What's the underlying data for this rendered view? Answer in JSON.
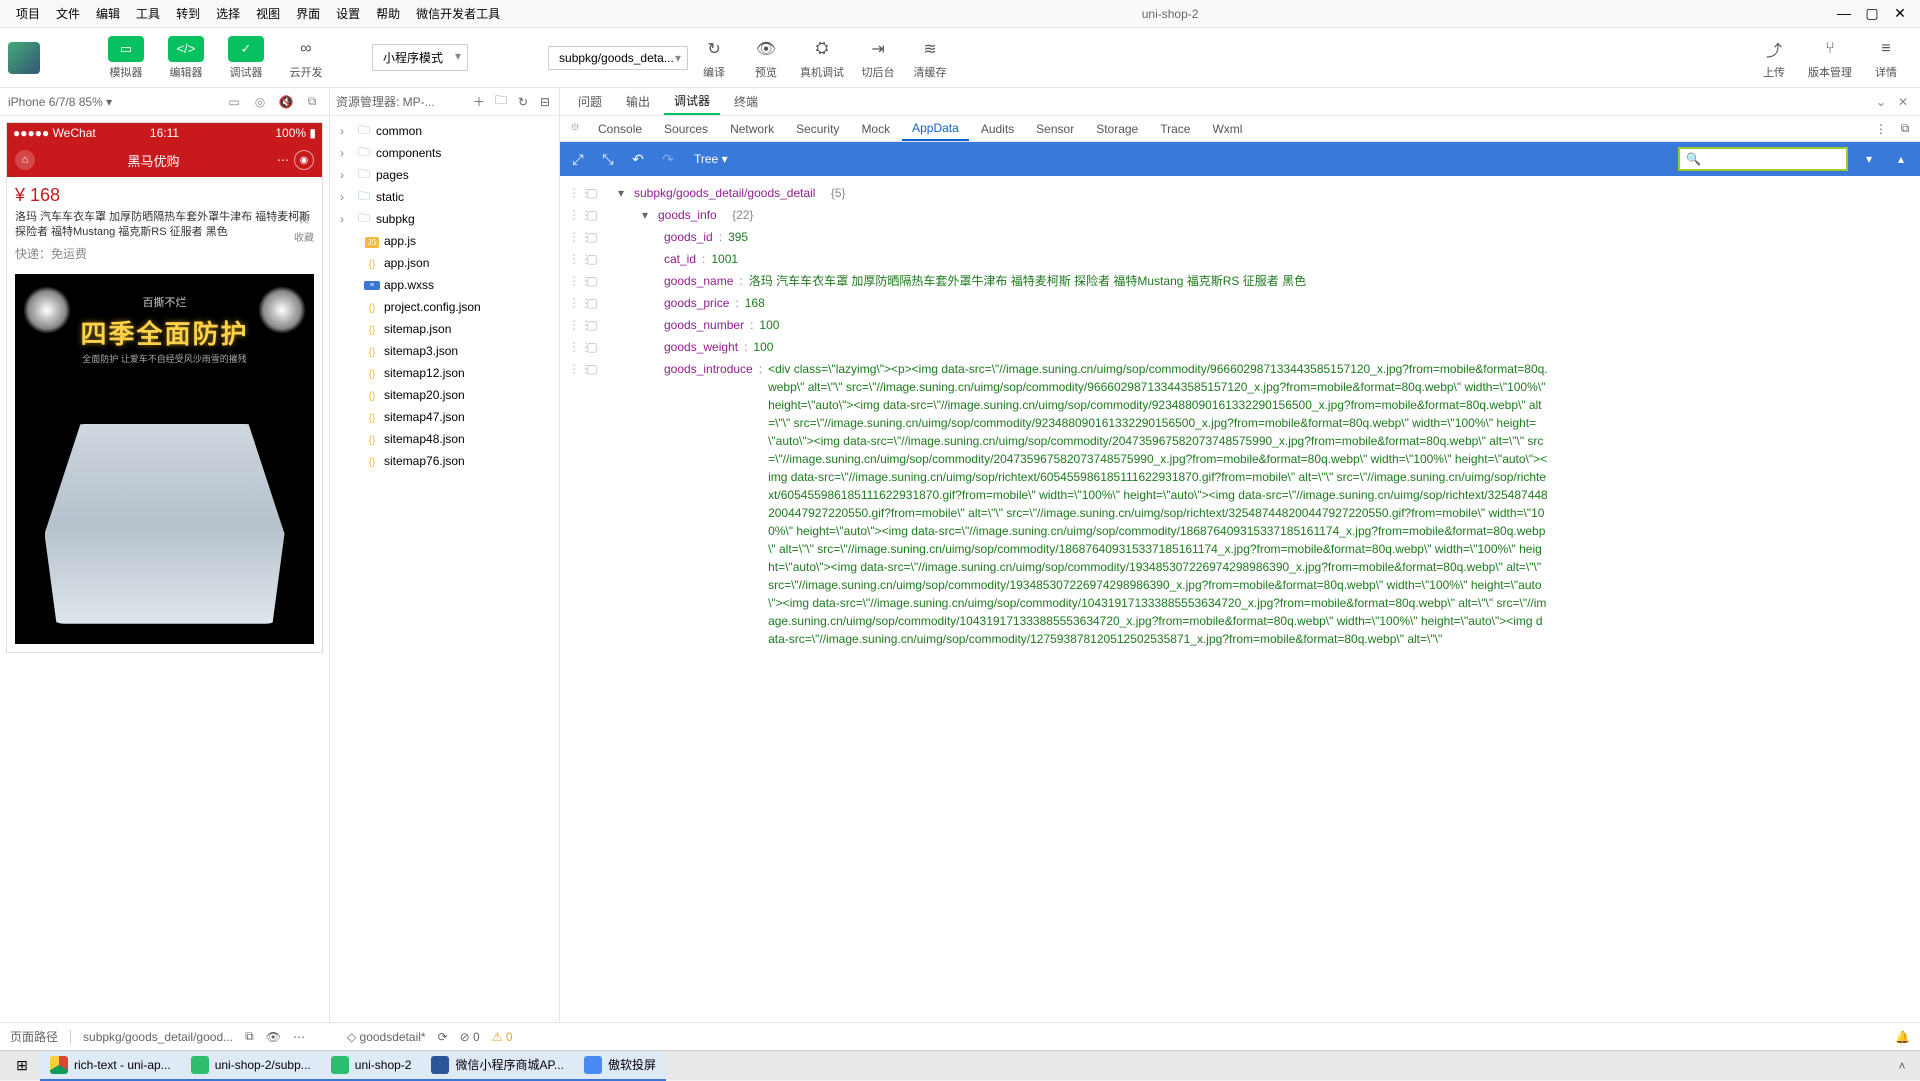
{
  "menu": [
    "项目",
    "文件",
    "编辑",
    "工具",
    "转到",
    "选择",
    "视图",
    "界面",
    "设置",
    "帮助",
    "微信开发者工具"
  ],
  "app_title": "uni-shop-2",
  "win": {
    "min": "—",
    "max": "▢",
    "close": "✕"
  },
  "toolbar": {
    "sim": "模拟器",
    "editor": "编辑器",
    "debugger": "调试器",
    "cloud": "云开发",
    "mode": "小程序模式",
    "page": "subpkg/goods_deta...",
    "compile": "编译",
    "preview": "预览",
    "realdebug": "真机调试",
    "background": "切后台",
    "clear": "清缓存",
    "upload": "上传",
    "version": "版本管理",
    "detail": "详情"
  },
  "sim": {
    "device": "iPhone 6/7/8 85%",
    "wechat": "●●●●● WeChat",
    "time": "16:11",
    "battery": "100%",
    "nav_title": "黑马优购"
  },
  "product": {
    "price": "¥ 168",
    "title": "洛玛 汽车车衣车罩 加厚防晒隔热车套外罩牛津布 福特麦柯斯 探险者 福特Mustang 福克斯RS 征服者 黑色",
    "fav": "收藏",
    "ship_label": "快递：",
    "ship_val": "免运费",
    "banner1": "百撕不烂",
    "banner2": "四季全面防护",
    "banner3": "全面防护 让爱车不自经受风沙雨雪的摧残"
  },
  "explorer": {
    "title": "资源管理器: MP-...",
    "folders": [
      "common",
      "components",
      "pages",
      "static",
      "subpkg"
    ],
    "files": [
      "app.js",
      "app.json",
      "app.wxss",
      "project.config.json",
      "sitemap.json",
      "sitemap3.json",
      "sitemap12.json",
      "sitemap20.json",
      "sitemap47.json",
      "sitemap48.json",
      "sitemap76.json"
    ]
  },
  "tabs_top": [
    "问题",
    "输出",
    "调试器",
    "终端"
  ],
  "tabs_top_active": "调试器",
  "dev_tabs": [
    "Console",
    "Sources",
    "Network",
    "Security",
    "Mock",
    "AppData",
    "Audits",
    "Sensor",
    "Storage",
    "Trace",
    "Wxml"
  ],
  "dev_active": "AppData",
  "tree_mode": "Tree",
  "appdata": {
    "path": "subpkg/goods_detail/goods_detail",
    "path_count": "{5}",
    "goods_info": "goods_info",
    "goods_info_count": "{22}",
    "goods_id_k": "goods_id",
    "goods_id_v": "395",
    "cat_id_k": "cat_id",
    "cat_id_v": "1001",
    "goods_name_k": "goods_name",
    "goods_name_v": "洛玛 汽车车衣车罩 加厚防晒隔热车套外罩牛津布 福特麦柯斯 探险者 福特Mustang 福克斯RS 征服者 黑色",
    "goods_price_k": "goods_price",
    "goods_price_v": "168",
    "goods_number_k": "goods_number",
    "goods_number_v": "100",
    "goods_weight_k": "goods_weight",
    "goods_weight_v": "100",
    "goods_introduce_k": "goods_introduce",
    "goods_introduce_v": "<div class=\\\"lazyimg\\\"><p><img data-src=\\\"//image.suning.cn/uimg/sop/commodity/966602987133443585157120_x.jpg?from=mobile&format=80q.webp\\\" alt=\\\"\\\" src=\\\"//image.suning.cn/uimg/sop/commodity/966602987133443585157120_x.jpg?from=mobile&format=80q.webp\\\" width=\\\"100%\\\" height=\\\"auto\\\"><img data-src=\\\"//image.suning.cn/uimg/sop/commodity/923488090161332290156500_x.jpg?from=mobile&format=80q.webp\\\" alt=\\\"\\\" src=\\\"//image.suning.cn/uimg/sop/commodity/923488090161332290156500_x.jpg?from=mobile&format=80q.webp\\\" width=\\\"100%\\\" height=\\\"auto\\\"><img data-src=\\\"//image.suning.cn/uimg/sop/commodity/204735967582073748575990_x.jpg?from=mobile&format=80q.webp\\\" alt=\\\"\\\" src=\\\"//image.suning.cn/uimg/sop/commodity/204735967582073748575990_x.jpg?from=mobile&format=80q.webp\\\" width=\\\"100%\\\" height=\\\"auto\\\"><img data-src=\\\"//image.suning.cn/uimg/sop/richtext/605455986185111622931870.gif?from=mobile\\\" alt=\\\"\\\" src=\\\"//image.suning.cn/uimg/sop/richtext/605455986185111622931870.gif?from=mobile\\\" width=\\\"100%\\\" height=\\\"auto\\\"><img data-src=\\\"//image.suning.cn/uimg/sop/richtext/325487448200447927220550.gif?from=mobile\\\" alt=\\\"\\\" src=\\\"//image.suning.cn/uimg/sop/richtext/325487448200447927220550.gif?from=mobile\\\" width=\\\"100%\\\" height=\\\"auto\\\"><img data-src=\\\"//image.suning.cn/uimg/sop/commodity/186876409315337185161174_x.jpg?from=mobile&format=80q.webp\\\" alt=\\\"\\\" src=\\\"//image.suning.cn/uimg/sop/commodity/186876409315337185161174_x.jpg?from=mobile&format=80q.webp\\\" width=\\\"100%\\\" height=\\\"auto\\\"><img data-src=\\\"//image.suning.cn/uimg/sop/commodity/193485307226974298986390_x.jpg?from=mobile&format=80q.webp\\\" alt=\\\"\\\" src=\\\"//image.suning.cn/uimg/sop/commodity/193485307226974298986390_x.jpg?from=mobile&format=80q.webp\\\" width=\\\"100%\\\" height=\\\"auto\\\"><img data-src=\\\"//image.suning.cn/uimg/sop/commodity/104319171333885553634720_x.jpg?from=mobile&format=80q.webp\\\" alt=\\\"\\\" src=\\\"//image.suning.cn/uimg/sop/commodity/104319171333885553634720_x.jpg?from=mobile&format=80q.webp\\\" width=\\\"100%\\\" height=\\\"auto\\\"><img data-src=\\\"//image.suning.cn/uimg/sop/commodity/127593878120512502535871_x.jpg?from=mobile&format=80q.webp\\\" alt=\\\"\\\""
  },
  "status": {
    "path_label": "页面路径",
    "path": "subpkg/goods_detail/good...",
    "tag": "goodsdetail*",
    "err": "0",
    "warn": "0"
  },
  "tasks": [
    {
      "cls": "chrome",
      "label": "rich-text - uni-ap..."
    },
    {
      "cls": "hb",
      "label": "uni-shop-2/subp..."
    },
    {
      "cls": "uni",
      "label": "uni-shop-2"
    },
    {
      "cls": "word",
      "label": "微信小程序商城AP..."
    },
    {
      "cls": "cast",
      "label": "傲软投屏"
    }
  ]
}
